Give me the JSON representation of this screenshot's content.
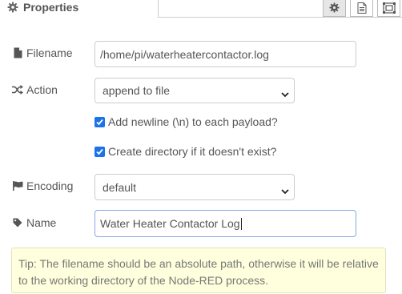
{
  "header": {
    "title": "Properties",
    "title_icon": "gear-icon",
    "buttons": [
      {
        "icon": "gear-icon",
        "active": true
      },
      {
        "icon": "description-icon",
        "active": false
      },
      {
        "icon": "appearance-icon",
        "active": false
      }
    ]
  },
  "form": {
    "filename": {
      "label": "Filename",
      "icon": "file-icon",
      "value": "/home/pi/waterheatercontactor.log"
    },
    "action": {
      "label": "Action",
      "icon": "random-icon",
      "value": "append to file"
    },
    "append_newline": {
      "label": "Add newline (\\n) to each payload?",
      "checked": true
    },
    "create_dir": {
      "label": "Create directory if it doesn't exist?",
      "checked": true
    },
    "encoding": {
      "label": "Encoding",
      "icon": "flag-icon",
      "value": "default"
    },
    "name": {
      "label": "Name",
      "icon": "tag-icon",
      "value": "Water Heater Contactor Log"
    }
  },
  "tip": {
    "line1": "Tip: The filename should be an absolute path, otherwise it will be relative",
    "line2": "to the working directory of the Node-RED process."
  },
  "colors": {
    "checkbox": "#1a73e8",
    "tip_background": "#ffffdd",
    "focus_border": "#85a9e4"
  }
}
